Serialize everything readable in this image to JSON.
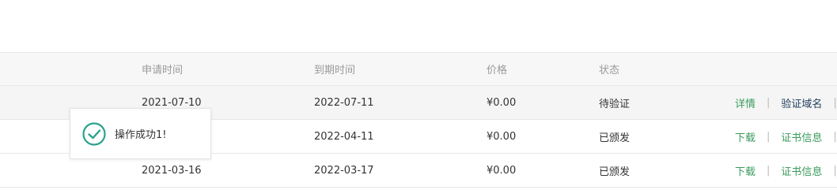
{
  "table": {
    "headers": {
      "apply_time": "申请时间",
      "expire_time": "到期时间",
      "price": "价格",
      "status": "状态"
    },
    "rows": [
      {
        "apply_time": "2021-07-10",
        "expire_time": "2022-07-11",
        "price": "¥0.00",
        "status": "待验证",
        "action1": "详情",
        "action2": "验证域名",
        "trail_sep": "|"
      },
      {
        "apply_time": "",
        "expire_time": "2022-04-11",
        "price": "¥0.00",
        "status": "已颁发",
        "action1": "下载",
        "action2": "证书信息",
        "trail_sep": "|"
      },
      {
        "apply_time": "2021-03-16",
        "expire_time": "2022-03-17",
        "price": "¥0.00",
        "status": "已颁发",
        "action1": "下载",
        "action2": "证书信息",
        "trail_sep": "|"
      }
    ],
    "separator": "|"
  },
  "toast": {
    "message": "操作成功1!",
    "icon": "check-circle-icon"
  },
  "colors": {
    "accent": "#3a9b5c",
    "link_dark": "#1c3b5a",
    "toast_icon": "#2aa38c"
  }
}
